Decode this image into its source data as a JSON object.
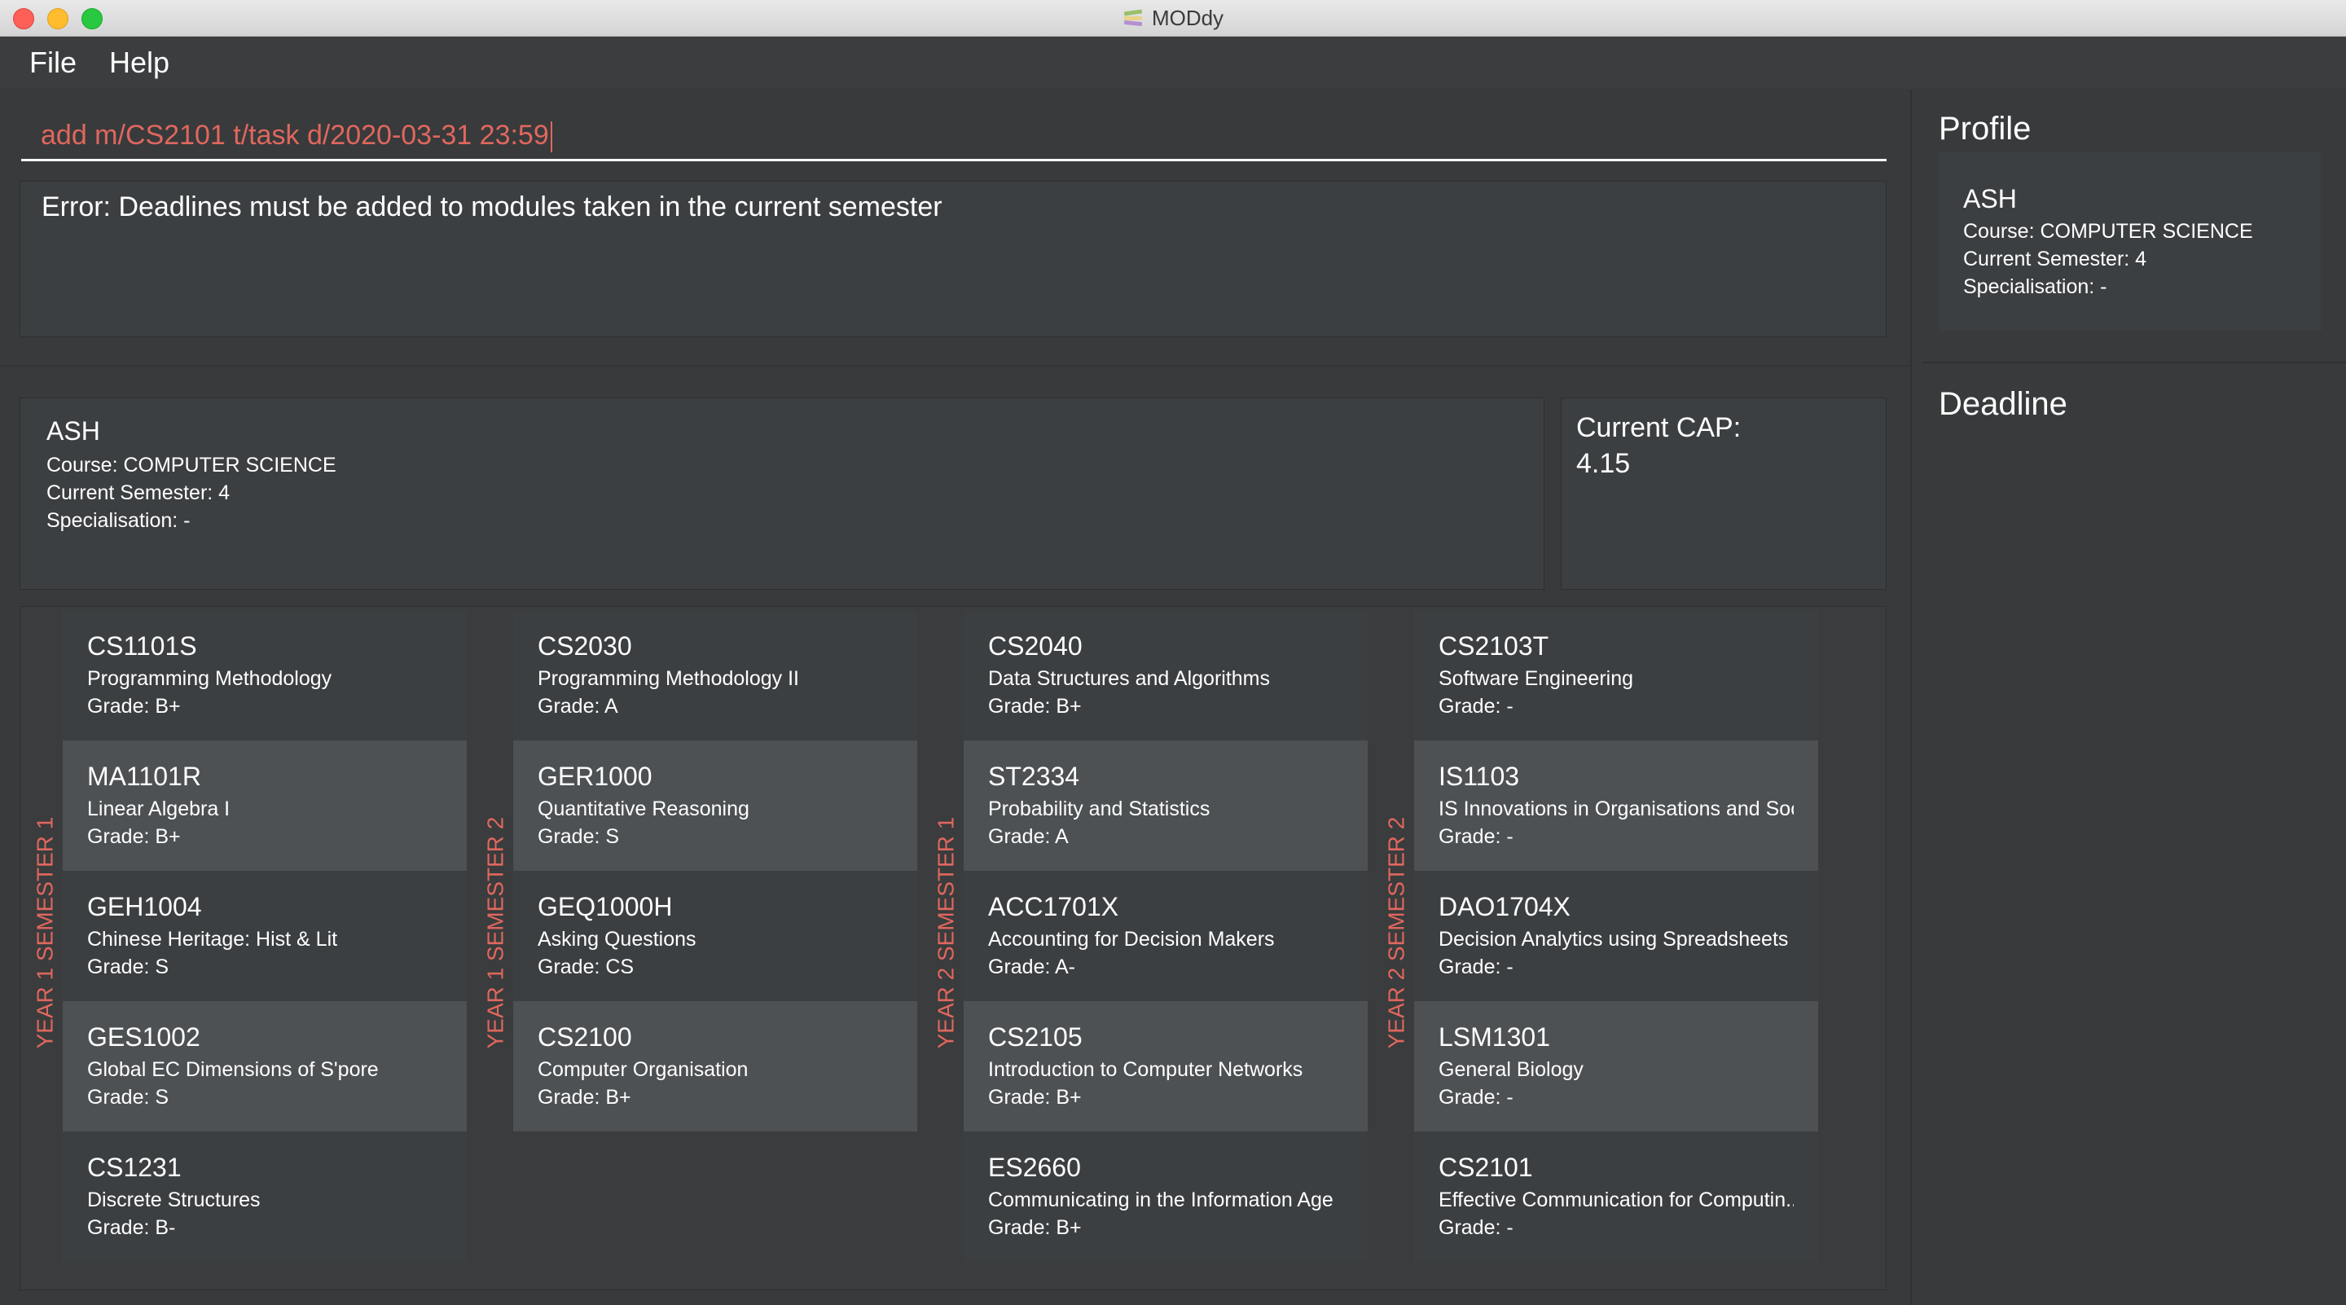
{
  "window": {
    "title": "MODdy"
  },
  "menu": {
    "file": "File",
    "help": "Help"
  },
  "command": {
    "value": "add m/CS2101 t/task d/2020-03-31 23:59"
  },
  "result": {
    "message": "Error: Deadlines must be added to modules taken in the current semester"
  },
  "profile": {
    "name": "ASH",
    "course": "Course: COMPUTER SCIENCE",
    "semester": "Current Semester: 4",
    "specialisation": "Specialisation: -"
  },
  "cap": {
    "label": "Current CAP:",
    "value": "4.15"
  },
  "semesters": [
    {
      "label": "YEAR 1 SEMESTER 1",
      "modules": [
        {
          "code": "CS1101S",
          "title": "Programming Methodology",
          "grade": "Grade: B+"
        },
        {
          "code": "MA1101R",
          "title": "Linear Algebra I",
          "grade": "Grade: B+"
        },
        {
          "code": "GEH1004",
          "title": "Chinese Heritage: Hist & Lit",
          "grade": "Grade: S"
        },
        {
          "code": "GES1002",
          "title": "Global EC Dimensions of S'pore",
          "grade": "Grade: S"
        },
        {
          "code": "CS1231",
          "title": "Discrete Structures",
          "grade": "Grade: B-"
        }
      ]
    },
    {
      "label": "YEAR 1 SEMESTER 2",
      "modules": [
        {
          "code": "CS2030",
          "title": "Programming Methodology II",
          "grade": "Grade: A"
        },
        {
          "code": "GER1000",
          "title": "Quantitative Reasoning",
          "grade": "Grade: S"
        },
        {
          "code": "GEQ1000H",
          "title": "Asking Questions",
          "grade": "Grade: CS"
        },
        {
          "code": "CS2100",
          "title": "Computer Organisation",
          "grade": "Grade: B+"
        }
      ]
    },
    {
      "label": "YEAR 2 SEMESTER 1",
      "modules": [
        {
          "code": "CS2040",
          "title": "Data Structures and Algorithms",
          "grade": "Grade: B+"
        },
        {
          "code": "ST2334",
          "title": "Probability and Statistics",
          "grade": "Grade: A"
        },
        {
          "code": "ACC1701X",
          "title": "Accounting for Decision Makers",
          "grade": "Grade: A-"
        },
        {
          "code": "CS2105",
          "title": "Introduction to Computer Networks",
          "grade": "Grade: B+"
        },
        {
          "code": "ES2660",
          "title": "Communicating in the Information Age",
          "grade": "Grade: B+"
        }
      ]
    },
    {
      "label": "YEAR 2 SEMESTER 2",
      "modules": [
        {
          "code": "CS2103T",
          "title": "Software Engineering",
          "grade": "Grade: -"
        },
        {
          "code": "IS1103",
          "title": "IS Innovations in Organisations and Soc...",
          "grade": "Grade: -"
        },
        {
          "code": "DAO1704X",
          "title": "Decision Analytics using Spreadsheets",
          "grade": "Grade: -"
        },
        {
          "code": "LSM1301",
          "title": "General Biology",
          "grade": "Grade: -"
        },
        {
          "code": "CS2101",
          "title": "Effective Communication for Computin...",
          "grade": "Grade: -"
        }
      ]
    }
  ],
  "sidebar": {
    "profile_title": "Profile",
    "deadline_title": "Deadline"
  }
}
